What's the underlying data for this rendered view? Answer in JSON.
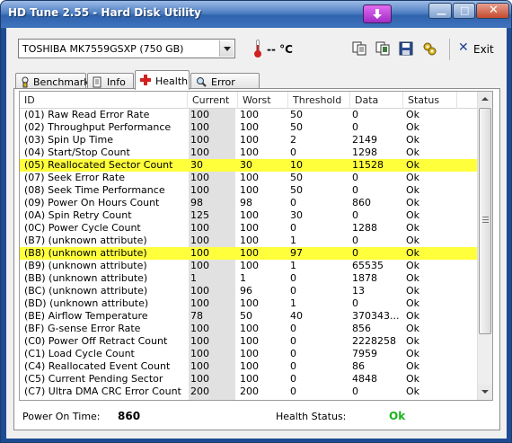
{
  "window": {
    "title": "HD Tune 2.55 - Hard Disk Utility"
  },
  "toolbar": {
    "drive": "TOSHIBA MK7559GSXP (750 GB)",
    "temperature": "-- °C",
    "exit_label": "Exit"
  },
  "tabs": [
    {
      "label": "Benchmark"
    },
    {
      "label": "Info"
    },
    {
      "label": "Health"
    },
    {
      "label": "Error Scan"
    }
  ],
  "table": {
    "headers": [
      "ID",
      "Current",
      "Worst",
      "Threshold",
      "Data",
      "Status"
    ],
    "rows": [
      {
        "id": "(01) Raw Read Error Rate",
        "current": "100",
        "worst": "100",
        "threshold": "50",
        "data": "0",
        "status": "Ok",
        "highlight": false
      },
      {
        "id": "(02) Throughput Performance",
        "current": "100",
        "worst": "100",
        "threshold": "50",
        "data": "0",
        "status": "Ok",
        "highlight": false
      },
      {
        "id": "(03) Spin Up Time",
        "current": "100",
        "worst": "100",
        "threshold": "2",
        "data": "2149",
        "status": "Ok",
        "highlight": false
      },
      {
        "id": "(04) Start/Stop Count",
        "current": "100",
        "worst": "100",
        "threshold": "0",
        "data": "1298",
        "status": "Ok",
        "highlight": false
      },
      {
        "id": "(05) Reallocated Sector Count",
        "current": "30",
        "worst": "30",
        "threshold": "10",
        "data": "11528",
        "status": "Ok",
        "highlight": true
      },
      {
        "id": "(07) Seek Error Rate",
        "current": "100",
        "worst": "100",
        "threshold": "50",
        "data": "0",
        "status": "Ok",
        "highlight": false
      },
      {
        "id": "(08) Seek Time Performance",
        "current": "100",
        "worst": "100",
        "threshold": "50",
        "data": "0",
        "status": "Ok",
        "highlight": false
      },
      {
        "id": "(09) Power On Hours Count",
        "current": "98",
        "worst": "98",
        "threshold": "0",
        "data": "860",
        "status": "Ok",
        "highlight": false
      },
      {
        "id": "(0A) Spin Retry Count",
        "current": "125",
        "worst": "100",
        "threshold": "30",
        "data": "0",
        "status": "Ok",
        "highlight": false
      },
      {
        "id": "(0C) Power Cycle Count",
        "current": "100",
        "worst": "100",
        "threshold": "0",
        "data": "1288",
        "status": "Ok",
        "highlight": false
      },
      {
        "id": "(B7) (unknown attribute)",
        "current": "100",
        "worst": "100",
        "threshold": "1",
        "data": "0",
        "status": "Ok",
        "highlight": false
      },
      {
        "id": "(B8) (unknown attribute)",
        "current": "100",
        "worst": "100",
        "threshold": "97",
        "data": "0",
        "status": "Ok",
        "highlight": true
      },
      {
        "id": "(B9) (unknown attribute)",
        "current": "100",
        "worst": "100",
        "threshold": "1",
        "data": "65535",
        "status": "Ok",
        "highlight": false
      },
      {
        "id": "(BB) (unknown attribute)",
        "current": "1",
        "worst": "1",
        "threshold": "0",
        "data": "1878",
        "status": "Ok",
        "highlight": false
      },
      {
        "id": "(BC) (unknown attribute)",
        "current": "100",
        "worst": "96",
        "threshold": "0",
        "data": "13",
        "status": "Ok",
        "highlight": false
      },
      {
        "id": "(BD) (unknown attribute)",
        "current": "100",
        "worst": "100",
        "threshold": "1",
        "data": "0",
        "status": "Ok",
        "highlight": false
      },
      {
        "id": "(BE) Airflow Temperature",
        "current": "78",
        "worst": "50",
        "threshold": "40",
        "data": "370343...",
        "status": "Ok",
        "highlight": false
      },
      {
        "id": "(BF) G-sense Error Rate",
        "current": "100",
        "worst": "100",
        "threshold": "0",
        "data": "856",
        "status": "Ok",
        "highlight": false
      },
      {
        "id": "(C0) Power Off Retract Count",
        "current": "100",
        "worst": "100",
        "threshold": "0",
        "data": "2228258",
        "status": "Ok",
        "highlight": false
      },
      {
        "id": "(C1) Load Cycle Count",
        "current": "100",
        "worst": "100",
        "threshold": "0",
        "data": "7959",
        "status": "Ok",
        "highlight": false
      },
      {
        "id": "(C4) Reallocated Event Count",
        "current": "100",
        "worst": "100",
        "threshold": "0",
        "data": "86",
        "status": "Ok",
        "highlight": false
      },
      {
        "id": "(C5) Current Pending Sector",
        "current": "100",
        "worst": "100",
        "threshold": "0",
        "data": "4848",
        "status": "Ok",
        "highlight": false
      },
      {
        "id": "(C7) Ultra DMA CRC Error Count",
        "current": "200",
        "worst": "200",
        "threshold": "0",
        "data": "0",
        "status": "Ok",
        "highlight": false
      }
    ]
  },
  "footer": {
    "power_on_label": "Power On Time:",
    "power_on_value": "860",
    "health_label": "Health Status:",
    "health_value": "Ok"
  },
  "colors": {
    "highlight": "#ffff3c",
    "health_ok": "#1bb31b",
    "shade_column": "#e1e1e1"
  }
}
